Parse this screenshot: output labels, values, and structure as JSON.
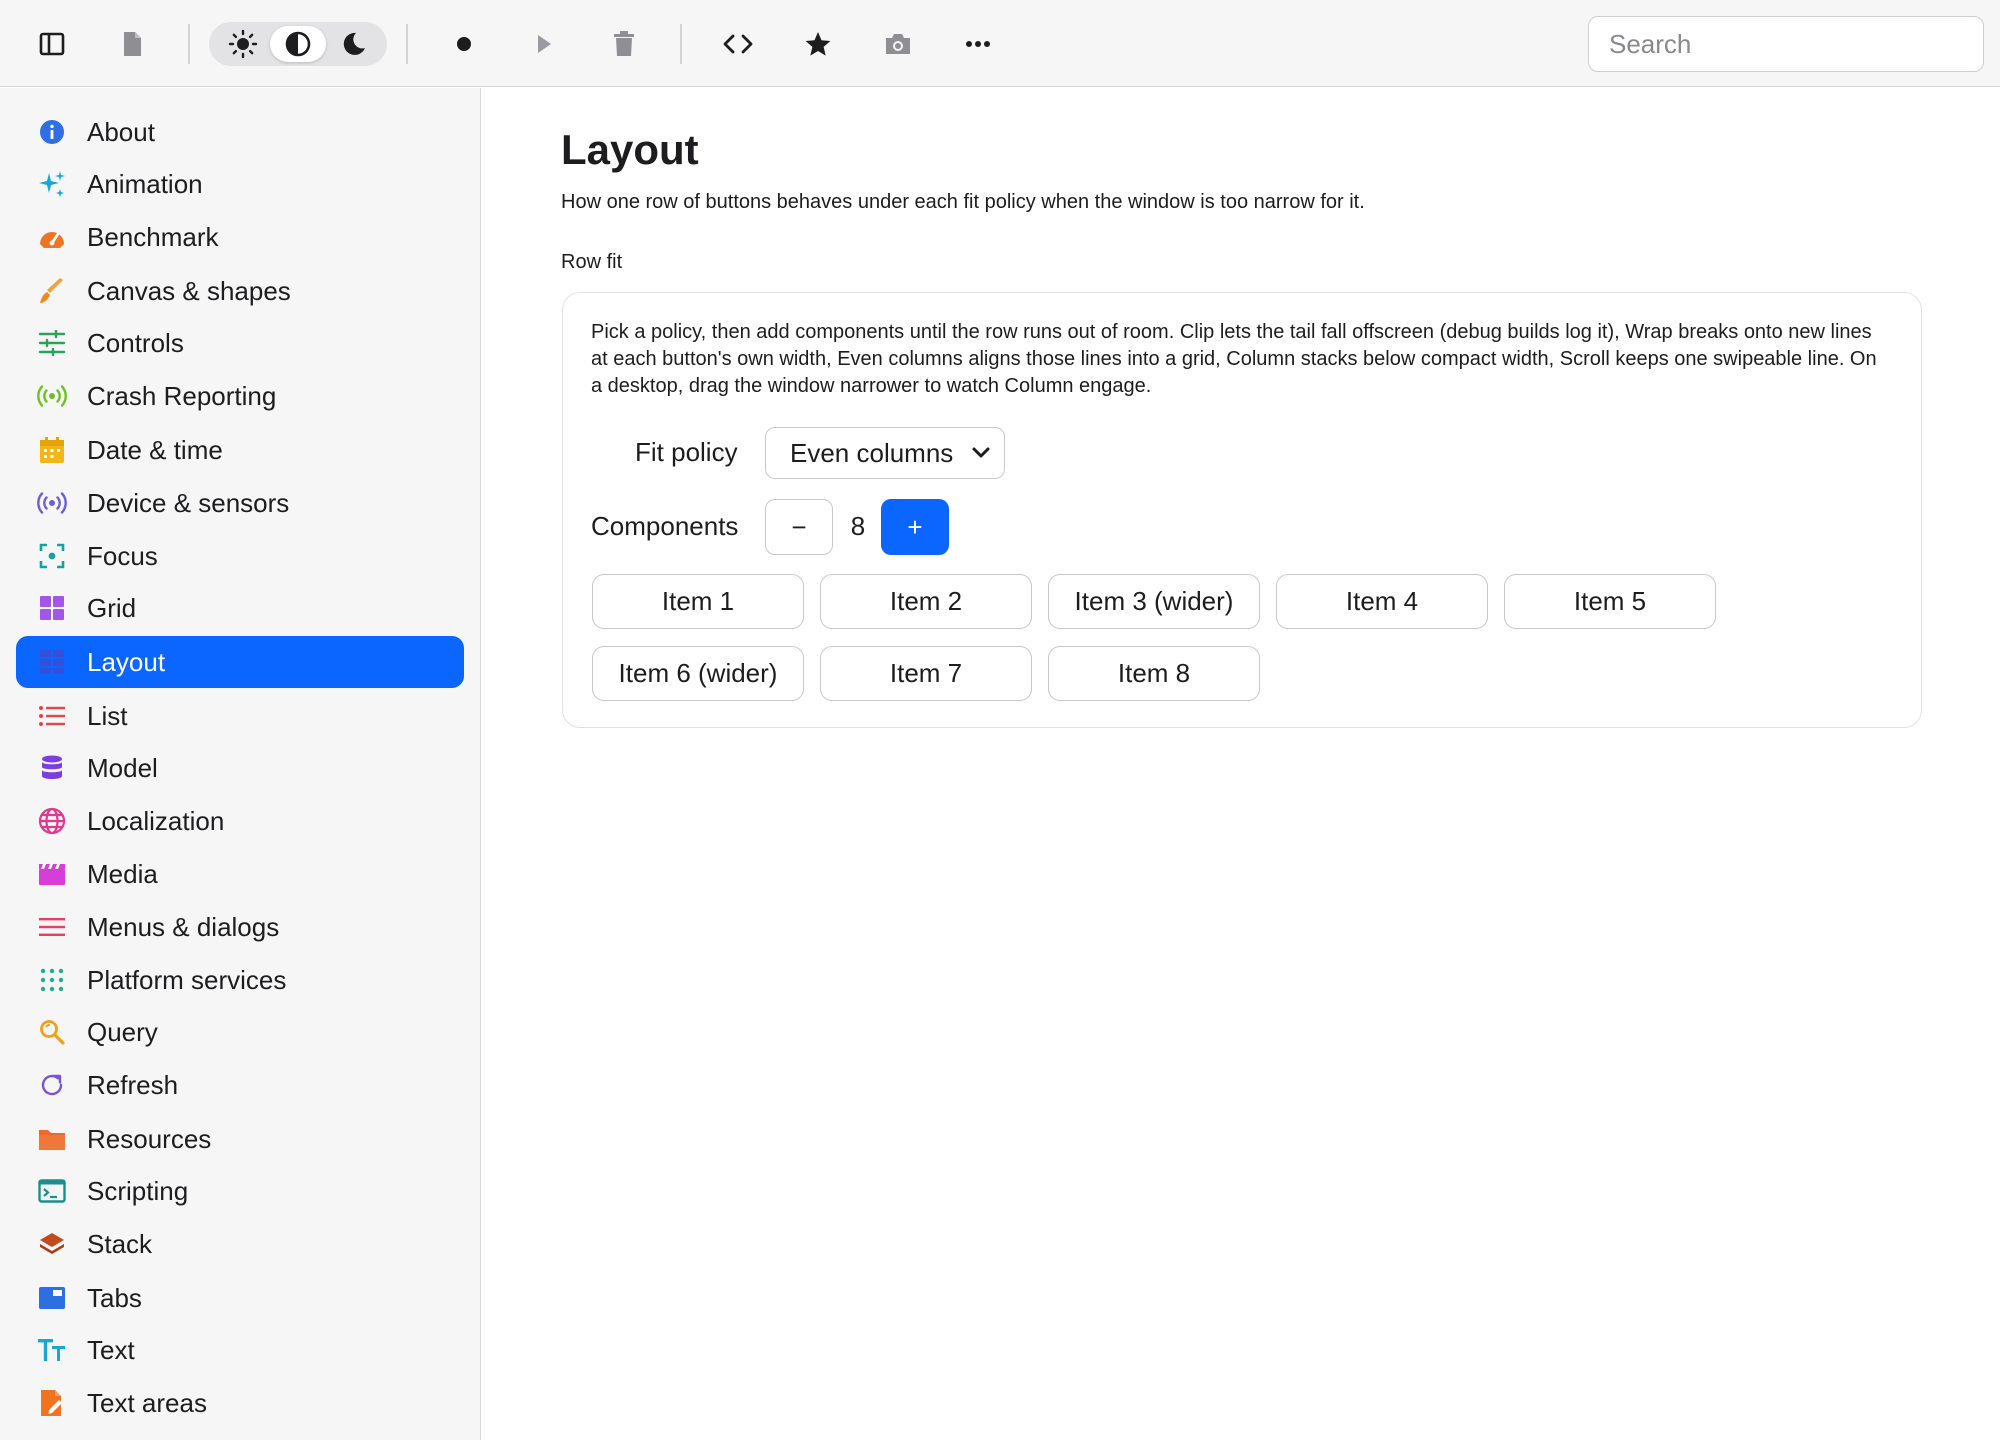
{
  "toolbar": {
    "search_placeholder": "Search",
    "icons": [
      "sidebar-icon",
      "document-icon",
      "sun-icon",
      "contrast-icon",
      "moon-icon",
      "record-icon",
      "play-icon",
      "trash-icon",
      "code-icon",
      "star-icon",
      "camera-icon",
      "more-icon"
    ],
    "theme_selected": "system"
  },
  "sidebar": {
    "items": [
      {
        "label": "About",
        "icon": "info-icon"
      },
      {
        "label": "Animation",
        "icon": "sparkles-icon"
      },
      {
        "label": "Benchmark",
        "icon": "gauge-icon"
      },
      {
        "label": "Canvas & shapes",
        "icon": "brush-icon"
      },
      {
        "label": "Controls",
        "icon": "sliders-icon"
      },
      {
        "label": "Crash Reporting",
        "icon": "broadcast-icon"
      },
      {
        "label": "Date & time",
        "icon": "calendar-icon"
      },
      {
        "label": "Device & sensors",
        "icon": "sensor-icon"
      },
      {
        "label": "Focus",
        "icon": "focus-icon"
      },
      {
        "label": "Grid",
        "icon": "grid-icon"
      },
      {
        "label": "Layout",
        "icon": "layout-icon",
        "active": true
      },
      {
        "label": "List",
        "icon": "list-icon"
      },
      {
        "label": "Model",
        "icon": "database-icon"
      },
      {
        "label": "Localization",
        "icon": "globe-icon"
      },
      {
        "label": "Media",
        "icon": "clapper-icon"
      },
      {
        "label": "Menus & dialogs",
        "icon": "menu-icon"
      },
      {
        "label": "Platform services",
        "icon": "dots-grid-icon"
      },
      {
        "label": "Query",
        "icon": "magnifier-icon"
      },
      {
        "label": "Refresh",
        "icon": "refresh-icon"
      },
      {
        "label": "Resources",
        "icon": "folder-icon"
      },
      {
        "label": "Scripting",
        "icon": "terminal-icon"
      },
      {
        "label": "Stack",
        "icon": "stack-icon"
      },
      {
        "label": "Tabs",
        "icon": "tabs-icon"
      },
      {
        "label": "Text",
        "icon": "text-icon"
      },
      {
        "label": "Text areas",
        "icon": "text-area-icon"
      }
    ]
  },
  "main": {
    "title": "Layout",
    "subtitle": "How one row of buttons behaves under each fit policy when the window is too narrow for it.",
    "section_label": "Row fit",
    "card": {
      "description": "Pick a policy, then add components until the row runs out of room. Clip lets the tail fall offscreen (debug builds log it), Wrap breaks onto new lines at each button's own width, Even columns aligns those lines into a grid, Column stacks below compact width, Scroll keeps one swipeable line. On a desktop, drag the window narrower to watch Column engage.",
      "fit_policy_label": "Fit policy",
      "fit_policy_value": "Even columns",
      "components_label": "Components",
      "minus_label": "−",
      "components_count": "8",
      "plus_label": "+",
      "items": [
        "Item 1",
        "Item 2",
        "Item 3 (wider)",
        "Item 4",
        "Item 5",
        "Item 6 (wider)",
        "Item 7",
        "Item 8"
      ]
    }
  },
  "colors": {
    "accent": "#0a66ff",
    "sidebar_bg": "#f6f6f7",
    "toolbar_bg": "#f6f6f6"
  }
}
